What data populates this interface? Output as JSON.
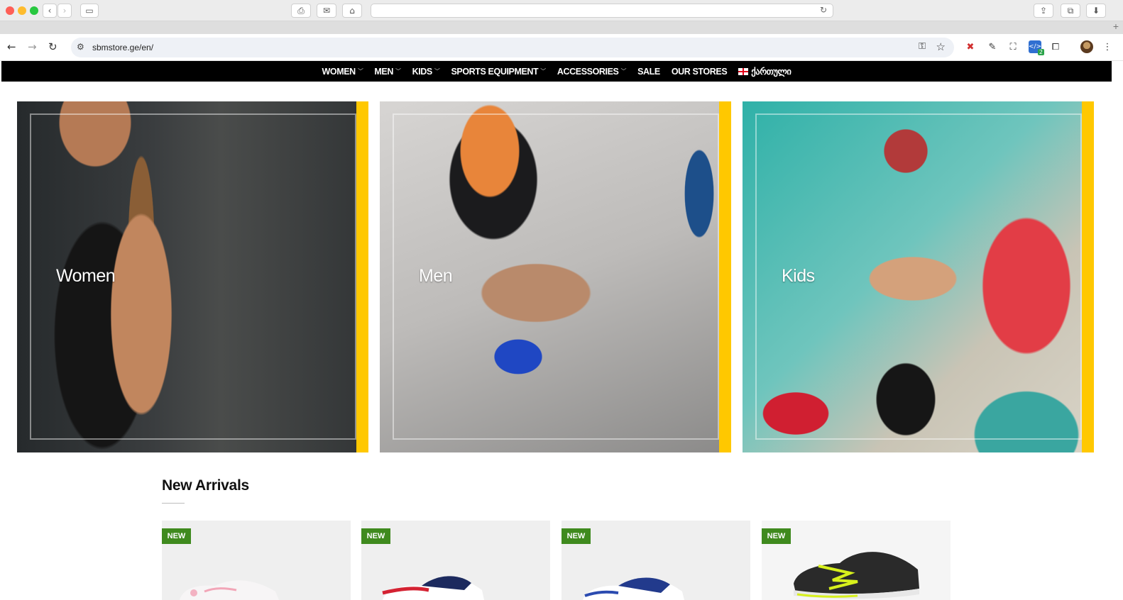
{
  "browser": {
    "url": "sbmstore.ge/en/",
    "extension_badge": "2"
  },
  "nav": {
    "items": [
      {
        "label": "WOMEN",
        "dropdown": true
      },
      {
        "label": "MEN",
        "dropdown": true
      },
      {
        "label": "KIDS",
        "dropdown": true
      },
      {
        "label": "SPORTS EQUIPMENT",
        "dropdown": true
      },
      {
        "label": "ACCESSORIES",
        "dropdown": true
      },
      {
        "label": "SALE",
        "dropdown": false
      },
      {
        "label": "OUR STORES",
        "dropdown": false
      }
    ],
    "language": "ქართული"
  },
  "categories": [
    {
      "label": "Women"
    },
    {
      "label": "Men"
    },
    {
      "label": "Kids"
    }
  ],
  "new_arrivals": {
    "title": "New Arrivals",
    "badge": "NEW"
  },
  "colors": {
    "nav_bg": "#000000",
    "accent_stripe": "#ffc800",
    "new_badge": "#3f8a1e"
  }
}
